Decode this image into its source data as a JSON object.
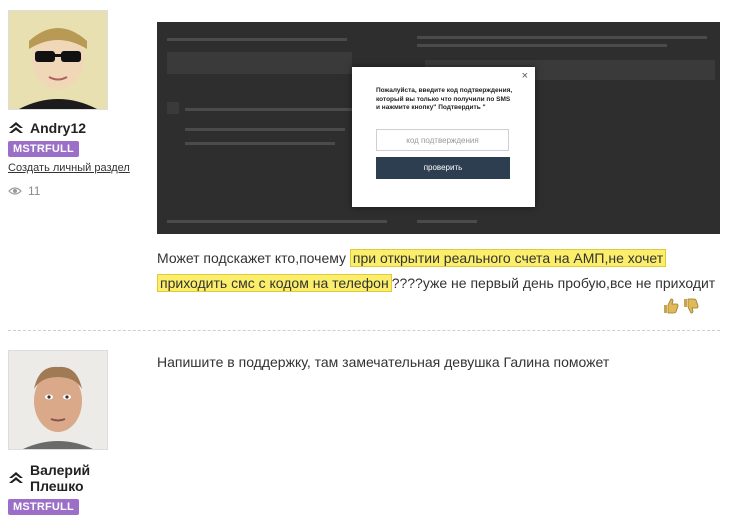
{
  "posts": [
    {
      "author": "Andry12",
      "badge": "MSTRFULL",
      "link": "Создать личный раздел",
      "views": "11",
      "text": {
        "before": "Может подскажет кто,почему",
        "hl1": "при открытии реального счета на АМП,не хочет",
        "hl2": "приходить смс с кодом на телефон",
        "after": "????уже не первый день пробую,все не приходит"
      },
      "screenshot": {
        "modal_text": "Пожалуйста, введите код подтверждения, который вы только что получили по SMS и нажмите кнопку\" Подтвердить \"",
        "input_placeholder": "код подтверждения",
        "button_label": "проверить",
        "close": "×"
      }
    },
    {
      "author_line1": "Валерий",
      "author_line2": "Плешко",
      "badge": "MSTRFULL",
      "text": "Напишите в поддержку, там замечательная девушка Галина поможет"
    }
  ],
  "colors": {
    "badge": "#9b6fc7",
    "highlight": "#fbee6a",
    "modal_button": "#2c3e50"
  },
  "icons": [
    "rank-chevrons-icon",
    "eye-icon",
    "thumbs-up-icon",
    "thumbs-down-icon",
    "close-icon"
  ]
}
